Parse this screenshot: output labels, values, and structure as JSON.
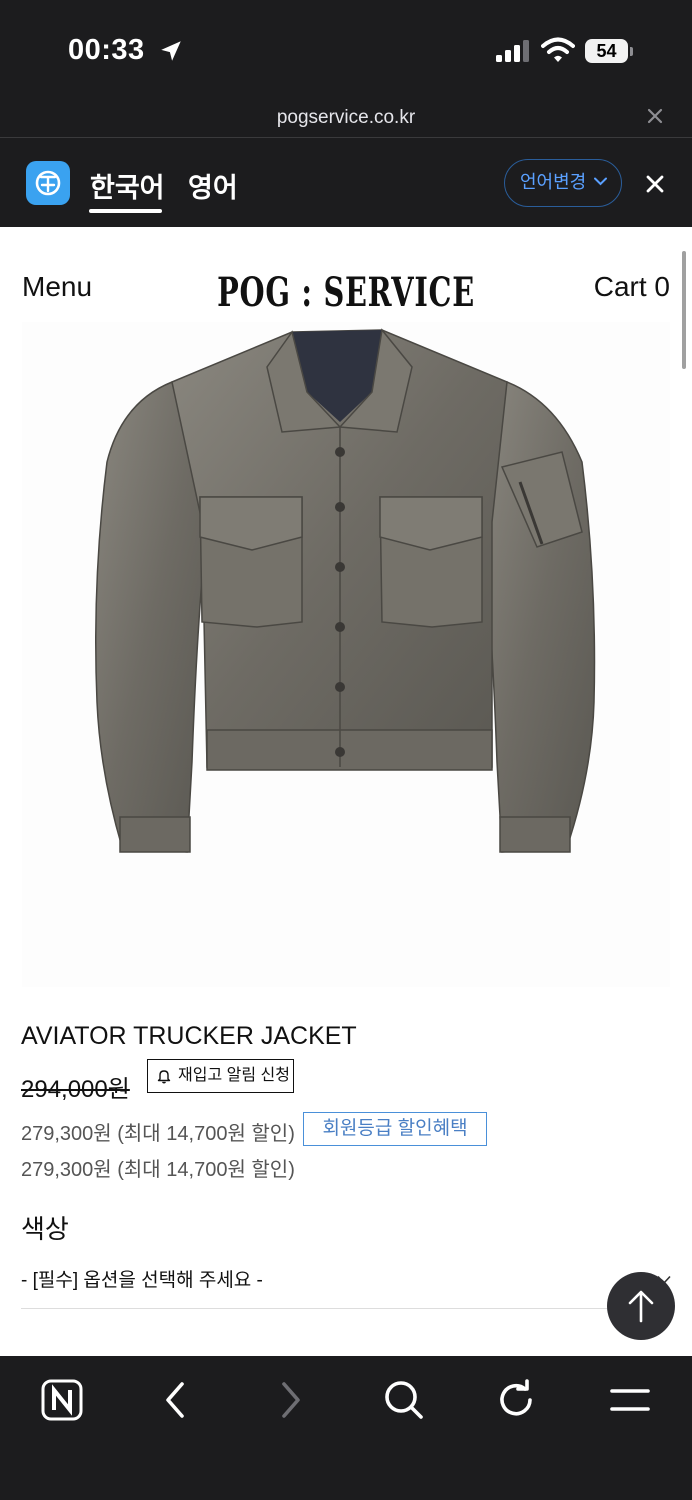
{
  "status_bar": {
    "time": "00:33",
    "battery": "54",
    "icons": [
      "location-arrow-icon",
      "cellular-signal-icon",
      "wifi-icon",
      "battery-icon"
    ]
  },
  "url_bar": {
    "url": "pogservice.co.kr"
  },
  "translate_bar": {
    "tab_korean": "한국어",
    "tab_english": "영어",
    "change_language": "언어변경",
    "accent": "#3aa2f0"
  },
  "header": {
    "menu": "Menu",
    "brand": "POG : SERVICE",
    "cart": "Cart 0"
  },
  "product": {
    "name": "AVIATOR TRUCKER JACKET",
    "original_price": "294,000원",
    "restock_button": "재입고 알림 신청",
    "price_line_1": "279,300원 (최대 14,700원 할인)",
    "member_button": "회원등급 할인혜택",
    "price_line_2": "279,300원 (최대 14,700원 할인)"
  },
  "options": {
    "color_title": "색상",
    "color_select_placeholder": "- [필수] 옵션을 선택해 주세요 -"
  },
  "toolbar": {
    "icons": [
      "naver-n-icon",
      "back-chevron-icon",
      "forward-chevron-icon",
      "search-icon",
      "reload-icon",
      "hamburger-menu-icon"
    ]
  }
}
